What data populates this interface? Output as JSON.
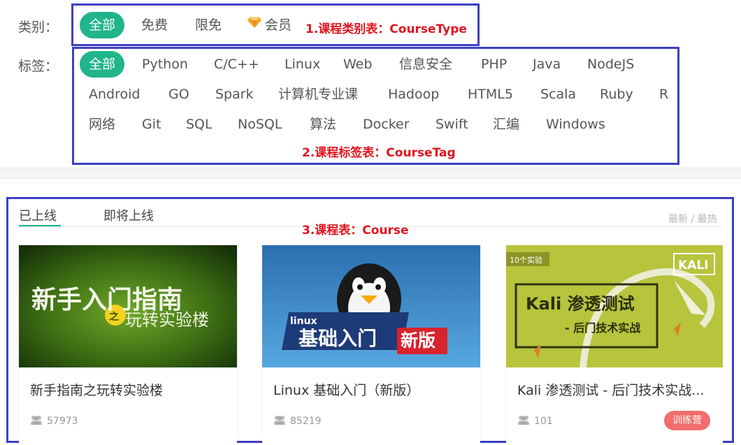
{
  "categories": {
    "label": "类别：",
    "items": [
      "全部",
      "免费",
      "限免",
      "会员"
    ],
    "active_index": 0,
    "member_icon": "diamond-icon",
    "annotation": "1.课程类别表：CourseType"
  },
  "tags": {
    "label": "标签：",
    "items": [
      "全部",
      "Python",
      "C/C++",
      "Linux",
      "Web",
      "信息安全",
      "PHP",
      "Java",
      "NodeJS",
      "Android",
      "GO",
      "Spark",
      "计算机专业课",
      "Hadoop",
      "HTML5",
      "Scala",
      "Ruby",
      "R",
      "网络",
      "Git",
      "SQL",
      "NoSQL",
      "算法",
      "Docker",
      "Swift",
      "汇编",
      "Windows"
    ],
    "active_index": 0,
    "annotation": "2.课程标签表：CourseTag"
  },
  "course_section": {
    "tabs": [
      "已上线",
      "即将上线"
    ],
    "active_tab": 0,
    "sort_label": "最新 / 最热",
    "annotation": "3.课程表：Course",
    "cards": [
      {
        "title": "新手指南之玩转实验楼",
        "learners": "57973",
        "thumb_line1": "新手入门指南",
        "thumb_zhi": "之",
        "thumb_line2": "玩转实验楼"
      },
      {
        "title": "Linux 基础入门（新版）",
        "learners": "85219",
        "thumb_tag": "linux",
        "thumb_main": "基础入门",
        "thumb_new": "新版"
      },
      {
        "title": "Kali 渗透测试 - 后门技术实战...",
        "learners": "101",
        "badge": "训练营",
        "thumb_corner": "10个实验",
        "thumb_logo": "KALI",
        "thumb_title": "Kali 渗透测试",
        "thumb_sub": "- 后门技术实战"
      }
    ]
  },
  "colors": {
    "accent": "#20b58a",
    "annotation_box": "#3c3fc4",
    "annotation_text": "#e0141e",
    "badge": "#f26d6d"
  }
}
